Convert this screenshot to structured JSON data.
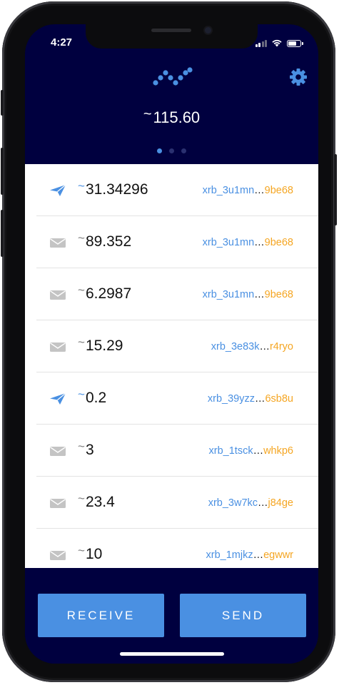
{
  "status": {
    "time": "4:27"
  },
  "header": {
    "balance_symbol": "~",
    "balance": "115.60",
    "page_count": 3,
    "active_page": 1
  },
  "transactions": [
    {
      "type": "send",
      "amount": "31.34296",
      "addr_start": "xrb_3u1mn",
      "addr_end": "9be68"
    },
    {
      "type": "receive",
      "amount": "89.352",
      "addr_start": "xrb_3u1mn",
      "addr_end": "9be68"
    },
    {
      "type": "receive",
      "amount": "6.2987",
      "addr_start": "xrb_3u1mn",
      "addr_end": "9be68"
    },
    {
      "type": "receive",
      "amount": "15.29",
      "addr_start": "xrb_3e83k",
      "addr_end": "r4ryo"
    },
    {
      "type": "send",
      "amount": "0.2",
      "addr_start": "xrb_39yzz",
      "addr_end": "6sb8u"
    },
    {
      "type": "receive",
      "amount": "3",
      "addr_start": "xrb_1tsck",
      "addr_end": "whkp6"
    },
    {
      "type": "receive",
      "amount": "23.4",
      "addr_start": "xrb_3w7kc",
      "addr_end": "j84ge"
    },
    {
      "type": "receive",
      "amount": "10",
      "addr_start": "xrb_1mjkz",
      "addr_end": "egwwr"
    }
  ],
  "actions": {
    "receive_label": "RECEIVE",
    "send_label": "SEND"
  },
  "colors": {
    "background": "#00003f",
    "accent": "#4a90e2",
    "address_end": "#f5a623"
  },
  "icons": {
    "send": "paper-plane-icon",
    "receive": "envelope-icon",
    "settings": "gear-icon",
    "logo": "nano-logo"
  }
}
